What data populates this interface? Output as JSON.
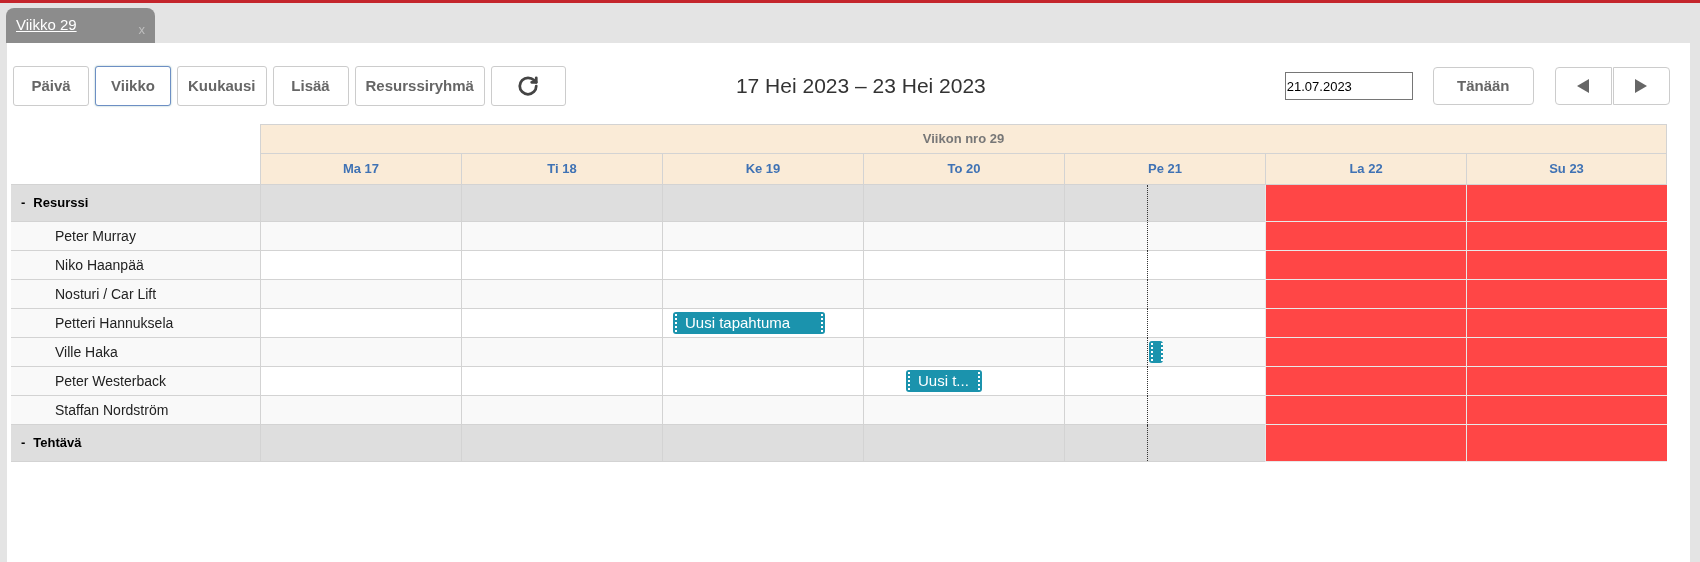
{
  "tab": {
    "title": "Viikko 29",
    "close": "x",
    "selected": true
  },
  "toolbar": {
    "views": [
      {
        "label": "Päivä",
        "selected": false
      },
      {
        "label": "Viikko",
        "selected": true
      },
      {
        "label": "Kuukausi",
        "selected": false
      },
      {
        "label": "Lisää",
        "selected": false
      },
      {
        "label": "Resurssiryhmä",
        "selected": false
      }
    ],
    "range_title": "17 Hei 2023 – 23 Hei 2023",
    "date_value": "21.07.2023",
    "today_button": "Tänään"
  },
  "calendar": {
    "week_label": "Viikon nro 29",
    "days": [
      {
        "label": "Ma 17",
        "weekend": false,
        "today": false
      },
      {
        "label": "Ti 18",
        "weekend": false,
        "today": false
      },
      {
        "label": "Ke 19",
        "weekend": false,
        "today": false
      },
      {
        "label": "To 20",
        "weekend": false,
        "today": false
      },
      {
        "label": "Pe 21",
        "weekend": false,
        "today": true
      },
      {
        "label": "La 22",
        "weekend": true,
        "today": false
      },
      {
        "label": "Su 23",
        "weekend": true,
        "today": false
      }
    ],
    "groups": [
      {
        "toggle": "-",
        "label": "Resurssi",
        "children": [
          {
            "name": "Peter Murray",
            "cells": [
              {},
              {},
              {},
              {},
              {},
              {},
              {}
            ]
          },
          {
            "name": "Niko Haanpää",
            "cells": [
              {},
              {},
              {},
              {},
              {},
              {},
              {}
            ]
          },
          {
            "name": "Nosturi / Car Lift",
            "cells": [
              {},
              {},
              {},
              {},
              {},
              {},
              {}
            ]
          },
          {
            "name": "Petteri Hannuksela",
            "cells": [
              {},
              {},
              {
                "event": {
                  "kind": "long",
                  "label": "Uusi tapahtuma"
                }
              },
              {},
              {},
              {},
              {}
            ]
          },
          {
            "name": "Ville Haka",
            "cells": [
              {},
              {},
              {},
              {},
              {
                "event": {
                  "kind": "stub"
                }
              },
              {},
              {}
            ]
          },
          {
            "name": "Peter Westerback",
            "cells": [
              {},
              {},
              {},
              {
                "event": {
                  "kind": "short",
                  "label": "Uusi t..."
                }
              },
              {},
              {},
              {}
            ]
          },
          {
            "name": "Staffan Nordström",
            "cells": [
              {},
              {},
              {},
              {},
              {},
              {},
              {}
            ]
          }
        ]
      },
      {
        "toggle": "-",
        "label": "Tehtävä"
      }
    ]
  }
}
